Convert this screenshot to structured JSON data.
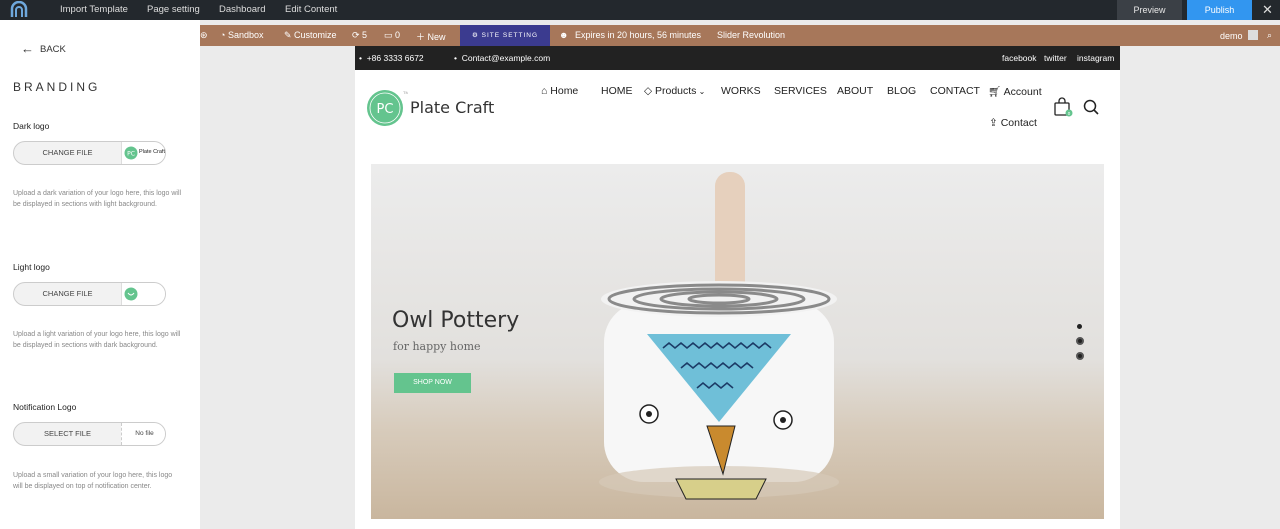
{
  "topbar": {
    "menu": [
      "Import Template",
      "Page setting",
      "Dashboard",
      "Edit Content"
    ],
    "preview_label": "Preview",
    "publish_label": "Publish",
    "close_icon": "close-icon"
  },
  "sidebar": {
    "back_label": "BACK",
    "heading": "BRANDING",
    "dark_logo": {
      "label": "Dark logo",
      "button": "CHANGE FILE",
      "thumb_text": "Plate Craft",
      "help": "Upload a dark variation of your logo here, this logo will be displayed in sections with light background."
    },
    "light_logo": {
      "label": "Light logo",
      "button": "CHANGE FILE",
      "help": "Upload a light variation of your logo here, this logo will be displayed in sections with dark background."
    },
    "notification_logo": {
      "label": "Notification Logo",
      "button": "SELECT FILE",
      "file_status": "No file",
      "help": "Upload a small variation of your logo here, this logo will be displayed on top of notification center."
    }
  },
  "adminbar": {
    "sandbox": "Sandbox",
    "customize": "Customize",
    "updates": "5",
    "comments": "0",
    "new": "New",
    "site_setting": "SITE SETTING",
    "expires": "Expires in 20 hours, 56 minutes",
    "slider": "Slider Revolution",
    "user": "demo"
  },
  "site": {
    "phone": "+86 3333 6672",
    "email": "Contact@example.com",
    "social": [
      "facebook",
      "twitter",
      "instagram"
    ],
    "brand_initials": "PC",
    "brand_tm": "TM",
    "brand_name": "Plate Craft",
    "nav": {
      "home": "Home",
      "home2": "HOME",
      "products": "Products",
      "works": "WORKS",
      "services": "SERVICES",
      "about": "ABOUT",
      "blog": "BLOG",
      "contact": "CONTACT",
      "account": "Account",
      "contact2": "Contact"
    },
    "cart_count": "0",
    "hero": {
      "title": "Owl Pottery",
      "subtitle": "for happy home",
      "button": "SHOP NOW"
    }
  },
  "colors": {
    "accent_green": "#64c48e",
    "publish_blue": "#3296f0",
    "adminbar_brown": "#a7775a",
    "site_setting_blue": "#3b3b8f"
  }
}
